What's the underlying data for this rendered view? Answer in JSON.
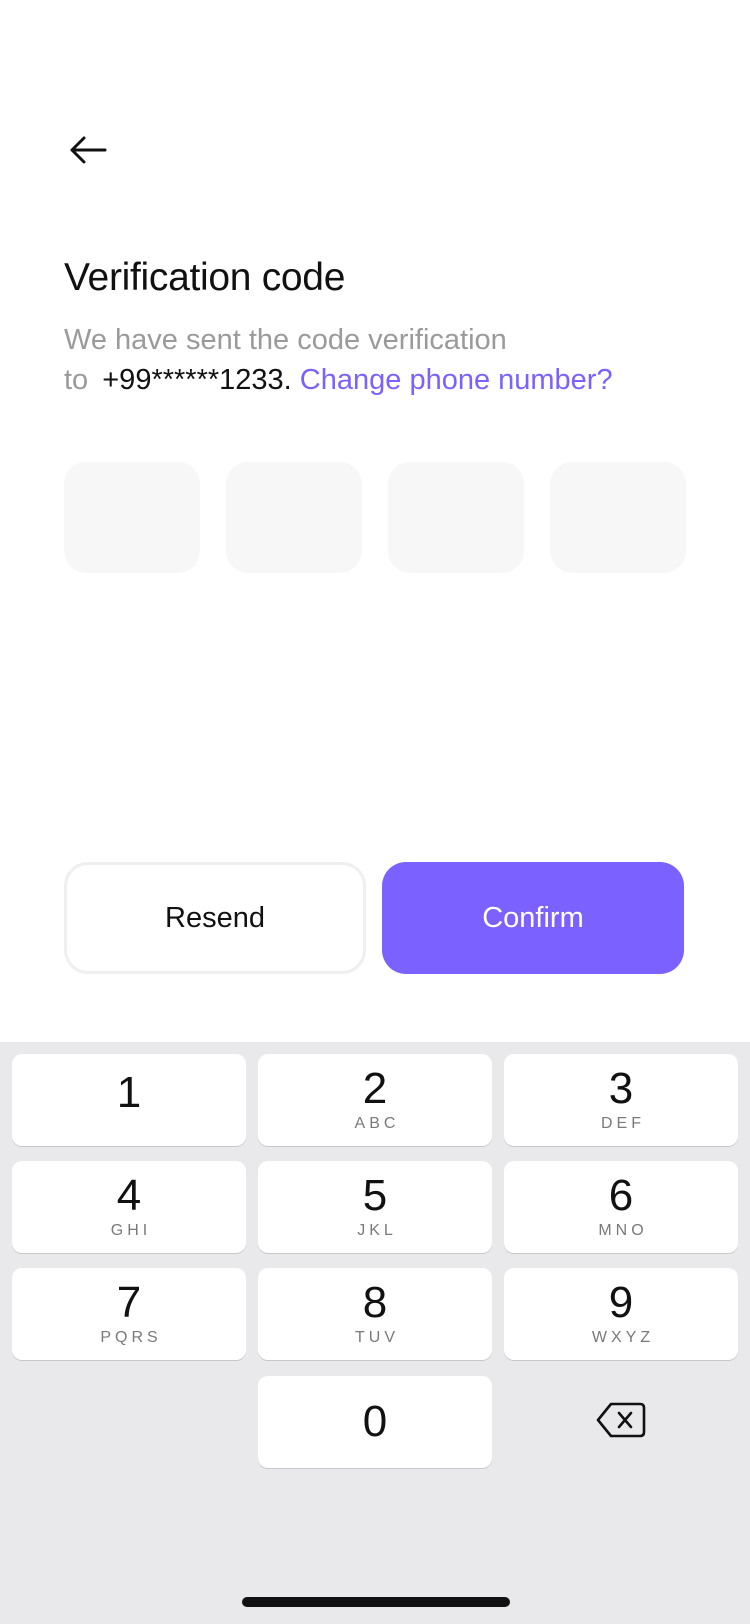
{
  "header": {
    "back_icon": "arrow-left-icon"
  },
  "verification": {
    "title": "Verification code",
    "subtitle_line1": "We have sent the code verification",
    "subtitle_to": "to",
    "phone_masked": "+99******1233.",
    "change_link": "Change phone number?"
  },
  "code_inputs": {
    "count": 4,
    "values": [
      "",
      "",
      "",
      ""
    ]
  },
  "buttons": {
    "resend_label": "Resend",
    "confirm_label": "Confirm"
  },
  "colors": {
    "accent": "#7b61ff",
    "input_bg": "#f7f7f7",
    "keyboard_bg": "#e9e9eb",
    "muted_text": "#9a9a9a"
  },
  "keypad": {
    "keys": [
      {
        "digit": "1",
        "letters": ""
      },
      {
        "digit": "2",
        "letters": "ABC"
      },
      {
        "digit": "3",
        "letters": "DEF"
      },
      {
        "digit": "4",
        "letters": "GHI"
      },
      {
        "digit": "5",
        "letters": "JKL"
      },
      {
        "digit": "6",
        "letters": "MNO"
      },
      {
        "digit": "7",
        "letters": "PQRS"
      },
      {
        "digit": "8",
        "letters": "TUV"
      },
      {
        "digit": "9",
        "letters": "WXYZ"
      },
      {
        "digit": "0",
        "letters": ""
      }
    ],
    "delete_icon": "backspace-icon"
  }
}
